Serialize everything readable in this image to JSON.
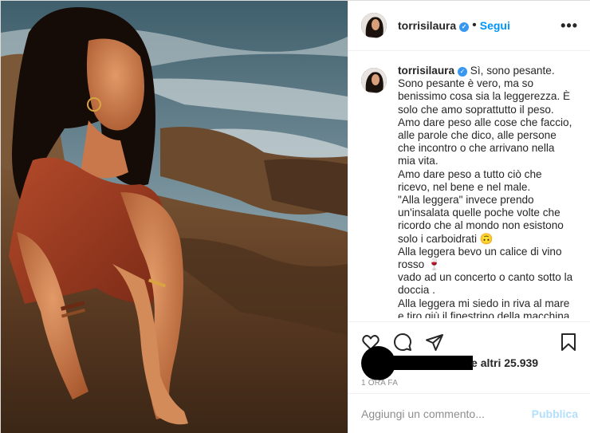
{
  "header": {
    "username": "torrisilaura",
    "verified_mark": "✓",
    "separator": "•",
    "follow_label": "Segui",
    "more_label": "•••"
  },
  "caption": {
    "username": "torrisilaura",
    "verified_mark": "✓",
    "text": " Sì, sono pesante.\nSono pesante è vero, ma so benissimo cosa sia la leggerezza. È solo che amo soprattutto il peso.\nAmo dare peso alle cose che faccio, alle parole che dico, alle persone che incontro o che arrivano nella mia vita.\nAmo dare peso a tutto ciò che ricevo, nel bene e nel male.\n\"Alla leggera\" invece prendo un'insalata quelle poche volte che ricordo che al mondo non esistono solo i carboidrati 🙃\nAlla leggera bevo un calice di vino rosso 🍷\nvado ad un concerto o canto sotto la doccia .\nAlla leggera mi siedo in riva al mare e tiro giù il finestrino della macchina"
  },
  "actions": {
    "like_icon": "heart-icon",
    "comment_icon": "comment-icon",
    "share_icon": "share-icon",
    "save_icon": "bookmark-icon"
  },
  "likes": {
    "suffix_e": "e",
    "others_text": "altri 25.939"
  },
  "timestamp": "1 ORA FA",
  "comment_box": {
    "placeholder": "Aggiungi un commento...",
    "publish_label": "Pubblica"
  },
  "colors": {
    "accent": "#0095f6",
    "publish_disabled": "#b2dffc",
    "verified": "#3897f0"
  }
}
